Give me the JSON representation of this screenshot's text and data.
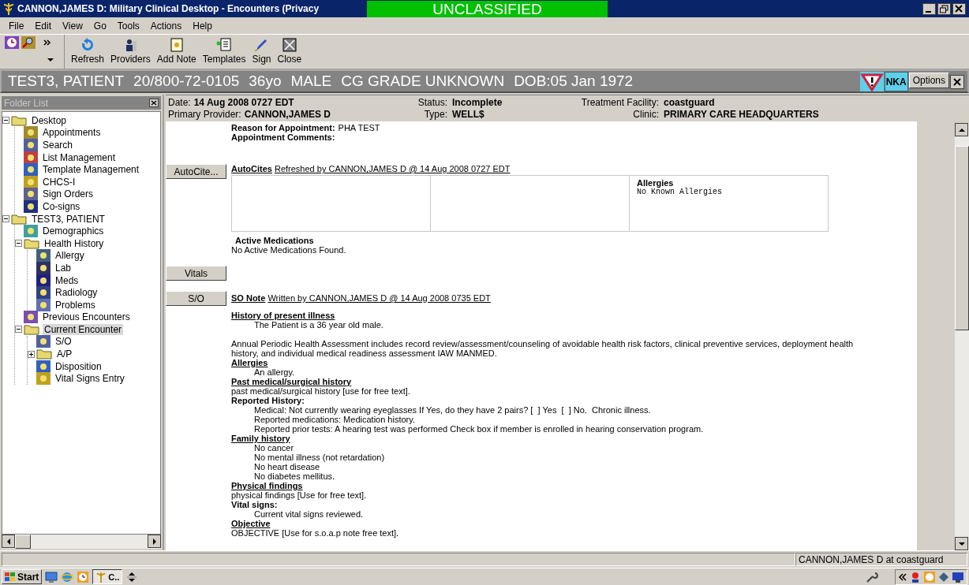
{
  "window": {
    "title": "CANNON,JAMES D: Military Clinical Desktop - Encounters (Privacy",
    "classification": "UNCLASSIFIED"
  },
  "menu": [
    "File",
    "Edit",
    "View",
    "Go",
    "Tools",
    "Actions",
    "Help"
  ],
  "toolbar": [
    {
      "kind": "refresh",
      "label": "Refresh"
    },
    {
      "kind": "providers",
      "label": "Providers"
    },
    {
      "kind": "note",
      "label": "Add Note"
    },
    {
      "kind": "templates",
      "label": "Templates"
    },
    {
      "kind": "sign",
      "label": "Sign"
    },
    {
      "kind": "close",
      "label": "Close"
    }
  ],
  "patient_banner": {
    "fields": [
      "TEST3, PATIENT",
      "20/800-72-0105",
      "36yo",
      "MALE",
      "CG GRADE UNKNOWN",
      "DOB:05 Jan 1972"
    ],
    "allergy_badge": "NKA",
    "options": "Options"
  },
  "folder_list": {
    "title": "Folder List",
    "tree": [
      {
        "label": "Desktop",
        "kind": "folder",
        "expanded": true,
        "selected": false,
        "children": [
          {
            "label": "Appointments",
            "kind": "item",
            "selected": false
          },
          {
            "label": "Search",
            "kind": "item",
            "selected": false
          },
          {
            "label": "List Management",
            "kind": "item",
            "selected": false
          },
          {
            "label": "Template Management",
            "kind": "item",
            "selected": false
          },
          {
            "label": "CHCS-I",
            "kind": "item",
            "selected": false
          },
          {
            "label": "Sign Orders",
            "kind": "item",
            "selected": false
          },
          {
            "label": "Co-signs",
            "kind": "item",
            "selected": false
          }
        ]
      },
      {
        "label": "TEST3, PATIENT",
        "kind": "folder",
        "expanded": true,
        "selected": false,
        "children": [
          {
            "label": "Demographics",
            "kind": "item",
            "selected": false
          },
          {
            "label": "Health History",
            "kind": "folder",
            "expanded": true,
            "selected": false,
            "children": [
              {
                "label": "Allergy",
                "kind": "item",
                "selected": false
              },
              {
                "label": "Lab",
                "kind": "item",
                "selected": false
              },
              {
                "label": "Meds",
                "kind": "item",
                "selected": false
              },
              {
                "label": "Radiology",
                "kind": "item",
                "selected": false
              },
              {
                "label": "Problems",
                "kind": "item",
                "selected": false
              }
            ]
          },
          {
            "label": "Previous Encounters",
            "kind": "item",
            "selected": false
          },
          {
            "label": "Current Encounter",
            "kind": "folder",
            "expanded": true,
            "selected": true,
            "children": [
              {
                "label": "S/O",
                "kind": "item",
                "selected": false
              },
              {
                "label": "A/P",
                "kind": "folder",
                "expanded": false,
                "selected": false
              },
              {
                "label": "Disposition",
                "kind": "item",
                "selected": false
              },
              {
                "label": "Vital Signs Entry",
                "kind": "item",
                "selected": false
              }
            ]
          }
        ]
      }
    ]
  },
  "encounter_header": [
    {
      "label": "Date:",
      "value": "14 Aug 2008 0727 EDT"
    },
    {
      "label": "Status:",
      "value": "Incomplete"
    },
    {
      "label": "Treatment Facility:",
      "value": "coastguard"
    },
    {
      "label": "Primary Provider:",
      "value": "CANNON,JAMES D"
    },
    {
      "label": "Type:",
      "value": "WELL$"
    },
    {
      "label": "Clinic:",
      "value": "PRIMARY CARE HEADQUARTERS"
    }
  ],
  "appointment": {
    "reason_label": "Reason for Appointment:",
    "reason_value": "PHA TEST",
    "comments_label": "Appointment Comments:"
  },
  "autocites": {
    "button": "AutoCite...",
    "title": "AutoCites",
    "byline": "Refreshed by CANNON,JAMES D @ 14 Aug 2008 0727 EDT",
    "allergies_heading": "Allergies",
    "allergies_text": "No Known Allergies",
    "medications_heading": "Active Medications",
    "medications_text": "No Active Medications Found."
  },
  "vitals_button": "Vitals",
  "so_note": {
    "button": "S/O",
    "title": "SO Note",
    "byline": "Written by CANNON,JAMES D @ 14 Aug 2008 0735 EDT",
    "lines": [
      {
        "kind": "heading",
        "text": "History of present illness"
      },
      {
        "kind": "indent",
        "text": "The Patient is a 36 year old male."
      },
      {
        "kind": "paragraph",
        "text": "Annual Periodic Health Assessment includes record review/assessment/counseling of avoidable health risk factors, clinical preventive services, deployment health history, and individual medical readiness assessment IAW MANMED."
      },
      {
        "kind": "heading",
        "text": "Allergies"
      },
      {
        "kind": "indent",
        "text": "An allergy."
      },
      {
        "kind": "heading",
        "text": "Past medical/surgical history"
      },
      {
        "kind": "text",
        "text": "past medical/surgical history [use for free text]."
      },
      {
        "kind": "label",
        "text": "Reported History:"
      },
      {
        "kind": "indent",
        "text": "Medical: Not currently wearing eyeglasses If Yes, do they have 2 pairs? [  ] Yes  [  ] No.  Chronic illness."
      },
      {
        "kind": "indent",
        "text": "Reported medications: Medication history."
      },
      {
        "kind": "indent",
        "text": "Reported prior tests: A hearing test was performed Check box if member is enrolled in hearing conservation program."
      },
      {
        "kind": "heading",
        "text": "Family history"
      },
      {
        "kind": "indent",
        "text": "No cancer"
      },
      {
        "kind": "indent",
        "text": "No mental illness (not retardation)"
      },
      {
        "kind": "indent",
        "text": "No heart disease"
      },
      {
        "kind": "indent",
        "text": "No diabetes mellitus."
      },
      {
        "kind": "heading",
        "text": "Physical findings"
      },
      {
        "kind": "text",
        "text": "physical findings [Use for free text]."
      },
      {
        "kind": "label",
        "text": "Vital signs:"
      },
      {
        "kind": "indent",
        "text": "Current vital signs reviewed."
      },
      {
        "kind": "heading",
        "text": "Objective"
      },
      {
        "kind": "text",
        "text": "OBJECTIVE [Use for s.o.a.p note free text]."
      }
    ]
  },
  "status_bar": {
    "user": "CANNON,JAMES D at coastguard"
  },
  "taskbar": {
    "start": "Start",
    "task": "C.."
  }
}
